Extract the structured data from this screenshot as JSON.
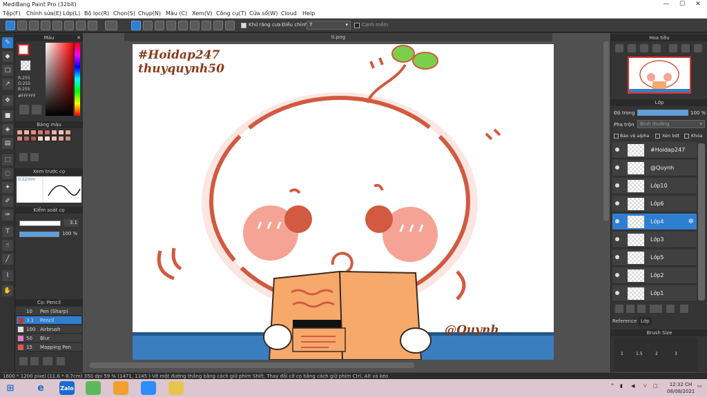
{
  "window": {
    "title": "MediBang Paint Pro (32bit)",
    "min": "—",
    "max": "☐",
    "close": "✕"
  },
  "menu": [
    "Tệp(F)",
    "Chỉnh sửa(E)",
    "Lớp(L)",
    "Bộ lọc(R)",
    "Chọn(S)",
    "Chụp(N)",
    "Màu (C)",
    "Xem(V)",
    "Công cụ(T)",
    "Cửa sổ(W)",
    "Cloud",
    "Help"
  ],
  "toolbar": {
    "antialias_label": "Khử răng cưa",
    "correction_label": "Điều chỉnh",
    "correction_value": "7",
    "snap_label": "Cạnh mềm"
  },
  "document": {
    "tab_name": "ti.png"
  },
  "color_panel": {
    "header": "Màu",
    "r": "R:255",
    "g": "G:255",
    "b": "B:255",
    "hex": "#FFFFFF"
  },
  "palette_panel": {
    "header": "Bảng màu",
    "swatches": [
      "#e9a89b",
      "#f1b7a9",
      "#df8f82",
      "#d47b6e",
      "#c96b5d",
      "#e5b3a8",
      "#f3c6bb",
      "#eaa496",
      "#cf8b7d",
      "#bb6b5e",
      "#a95a4f",
      "#f6d2c9",
      "#f8e1da",
      "#e6c2b8",
      "#d9a99c",
      "#c79082"
    ]
  },
  "brush_preview": {
    "header": "Xem trước cọ",
    "size": "0.22mm"
  },
  "brush_control": {
    "header": "Kiểm soát cọ",
    "size_value": "3.1",
    "opacity_value": "100 %"
  },
  "brush_list": {
    "header": "Cọ: Pencil",
    "items": [
      {
        "size": "10",
        "name": "Pen (Sharp)",
        "color": "#3a3a3a"
      },
      {
        "size": "3.1",
        "name": "Pencil",
        "color": "#c0392b"
      },
      {
        "size": "100",
        "name": "Airbrush",
        "color": "#dddddd"
      },
      {
        "size": "50",
        "name": "Blur",
        "color": "#e879c5"
      },
      {
        "size": "15",
        "name": "Mapping Pen",
        "color": "#e05555"
      }
    ]
  },
  "artwork": {
    "watermark_line1": "#Hoidap247",
    "watermark_line2": "thuyquynh50",
    "signature": "@Quynh"
  },
  "navigator": {
    "header": "Hoa tiêu"
  },
  "layers_panel": {
    "header": "Lớp",
    "opacity_label": "Độ trong",
    "opacity_value": "100 %",
    "blend_label": "Pha trộn",
    "blend_value": "Bình thường",
    "protect_alpha": "Bảo vệ alpha",
    "clipping": "Xén bớt",
    "lock": "Khóa",
    "layers": [
      {
        "name": "#Hoidap247",
        "selected": false
      },
      {
        "name": "@Quynh",
        "selected": false
      },
      {
        "name": "Lớp10",
        "selected": false
      },
      {
        "name": "Lớp6",
        "selected": false
      },
      {
        "name": "Lớp4",
        "selected": true
      },
      {
        "name": "Lớp3",
        "selected": false
      },
      {
        "name": "Lớp5",
        "selected": false
      },
      {
        "name": "Lớp2",
        "selected": false
      },
      {
        "name": "Lớp1",
        "selected": false
      }
    ],
    "tab_reference": "Reference",
    "tab_layer": "Lớp"
  },
  "brush_size_panel": {
    "header": "Brush Size",
    "sizes": [
      "1",
      "1.5",
      "2",
      "3"
    ]
  },
  "status": {
    "text": "1600 * 1200 pixel  (11.6 * 8.7cm)  350 dpi  59 %  (1471, 1145 )  Vẽ một đường thẳng bằng cách giữ phím Shift, Thay đổi cỡ cọ bằng cách giữ phím Ctrl, Alt và kéo"
  },
  "taskbar": {
    "zalo": "Zalo",
    "time": "12:32 CH",
    "date": "08/08/2021"
  },
  "colors": {
    "accent": "#2f7fd1",
    "line_red": "#d15a40",
    "cheek": "#f5a394",
    "orange_box": "#f7a86b",
    "sprout": "#7ccf4a",
    "blue_stripe": "#3a7ec0"
  }
}
